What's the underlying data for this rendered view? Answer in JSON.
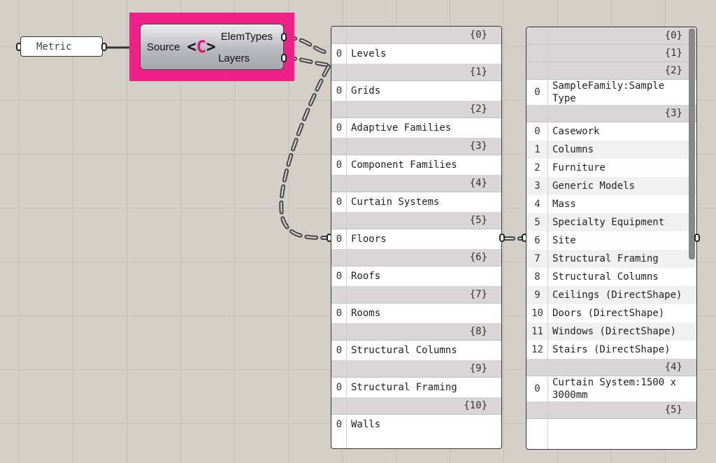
{
  "panel": {
    "label": "Metric"
  },
  "component": {
    "input_label": "Source",
    "output_1": "ElemTypes",
    "output_2": "Layers",
    "icon_left": "<",
    "icon_mid": "C",
    "icon_right": ">"
  },
  "tree_left": {
    "branches": [
      {
        "path": "{0}",
        "items": [
          {
            "index": "0",
            "value": "Levels"
          }
        ]
      },
      {
        "path": "{1}",
        "items": [
          {
            "index": "0",
            "value": "Grids"
          }
        ]
      },
      {
        "path": "{2}",
        "items": [
          {
            "index": "0",
            "value": "Adaptive Families"
          }
        ]
      },
      {
        "path": "{3}",
        "items": [
          {
            "index": "0",
            "value": "Component Families"
          }
        ]
      },
      {
        "path": "{4}",
        "items": [
          {
            "index": "0",
            "value": "Curtain Systems"
          }
        ]
      },
      {
        "path": "{5}",
        "items": [
          {
            "index": "0",
            "value": "Floors"
          }
        ]
      },
      {
        "path": "{6}",
        "items": [
          {
            "index": "0",
            "value": "Roofs"
          }
        ]
      },
      {
        "path": "{7}",
        "items": [
          {
            "index": "0",
            "value": "Rooms"
          }
        ]
      },
      {
        "path": "{8}",
        "items": [
          {
            "index": "0",
            "value": "Structural Columns"
          }
        ]
      },
      {
        "path": "{9}",
        "items": [
          {
            "index": "0",
            "value": "Structural Framing"
          }
        ]
      },
      {
        "path": "{10}",
        "items": [
          {
            "index": "0",
            "value": "Walls"
          }
        ]
      }
    ]
  },
  "tree_right": {
    "branches": [
      {
        "path": "{0}",
        "items": []
      },
      {
        "path": "{1}",
        "items": []
      },
      {
        "path": "{2}",
        "items": [
          {
            "index": "0",
            "value": "SampleFamily:Sample Type"
          }
        ]
      },
      {
        "path": "{3}",
        "items": [
          {
            "index": "0",
            "value": "Casework"
          },
          {
            "index": "1",
            "value": "Columns"
          },
          {
            "index": "2",
            "value": "Furniture"
          },
          {
            "index": "3",
            "value": "Generic Models"
          },
          {
            "index": "4",
            "value": "Mass"
          },
          {
            "index": "5",
            "value": "Specialty Equipment"
          },
          {
            "index": "6",
            "value": "Site"
          },
          {
            "index": "7",
            "value": "Structural Framing"
          },
          {
            "index": "8",
            "value": "Structural Columns"
          },
          {
            "index": "9",
            "value": "Ceilings (DirectShape)"
          },
          {
            "index": "10",
            "value": "Doors (DirectShape)"
          },
          {
            "index": "11",
            "value": "Windows (DirectShape)"
          },
          {
            "index": "12",
            "value": "Stairs (DirectShape)"
          }
        ]
      },
      {
        "path": "{4}",
        "items": [
          {
            "index": "0",
            "value": "Curtain System:1500 x 3000mm"
          }
        ]
      },
      {
        "path": "{5}",
        "items": []
      }
    ]
  },
  "colors": {
    "canvas": "#d4d0c8",
    "selection": "#f0208a",
    "wire": "#555555"
  }
}
